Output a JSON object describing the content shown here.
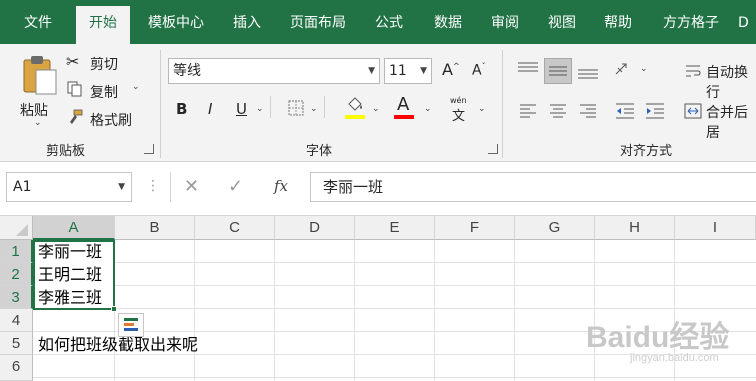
{
  "menu": {
    "tabs": [
      "文件",
      "开始",
      "模板中心",
      "插入",
      "页面布局",
      "公式",
      "数据",
      "审阅",
      "视图",
      "帮助",
      "方方格子",
      "D"
    ],
    "active_index": 1
  },
  "ribbon": {
    "clipboard": {
      "paste_label": "粘贴",
      "cut_label": "剪切",
      "copy_label": "复制",
      "format_painter_label": "格式刷",
      "group_label": "剪贴板"
    },
    "font": {
      "font_name": "等线",
      "font_size": "11",
      "grow_label": "A",
      "shrink_label": "A",
      "bold_label": "B",
      "italic_label": "I",
      "underline_label": "U",
      "font_color_label": "A",
      "phonetic_label": "文",
      "phonetic_top": "wén",
      "group_label": "字体",
      "highlight_color": "#ffff00",
      "font_color": "#ff0000"
    },
    "alignment": {
      "wrap_text_label": "自动换行",
      "merge_center_label": "合并后居",
      "group_label": "对齐方式"
    }
  },
  "formula_bar": {
    "name_box": "A1",
    "fx_label": "fx",
    "content": "李丽一班"
  },
  "sheet": {
    "columns": [
      "A",
      "B",
      "C",
      "D",
      "E",
      "F",
      "G",
      "H",
      "I"
    ],
    "rows": [
      "1",
      "2",
      "3",
      "4",
      "5",
      "6"
    ],
    "cells": {
      "A1": "李丽一班",
      "A2": "王明二班",
      "A3": "李雅三班",
      "A5": "如何把班级截取出来呢"
    },
    "accent_color": "#217346"
  },
  "watermark": {
    "brand": "Baidu经验",
    "url": "jingyan.baidu.com"
  }
}
